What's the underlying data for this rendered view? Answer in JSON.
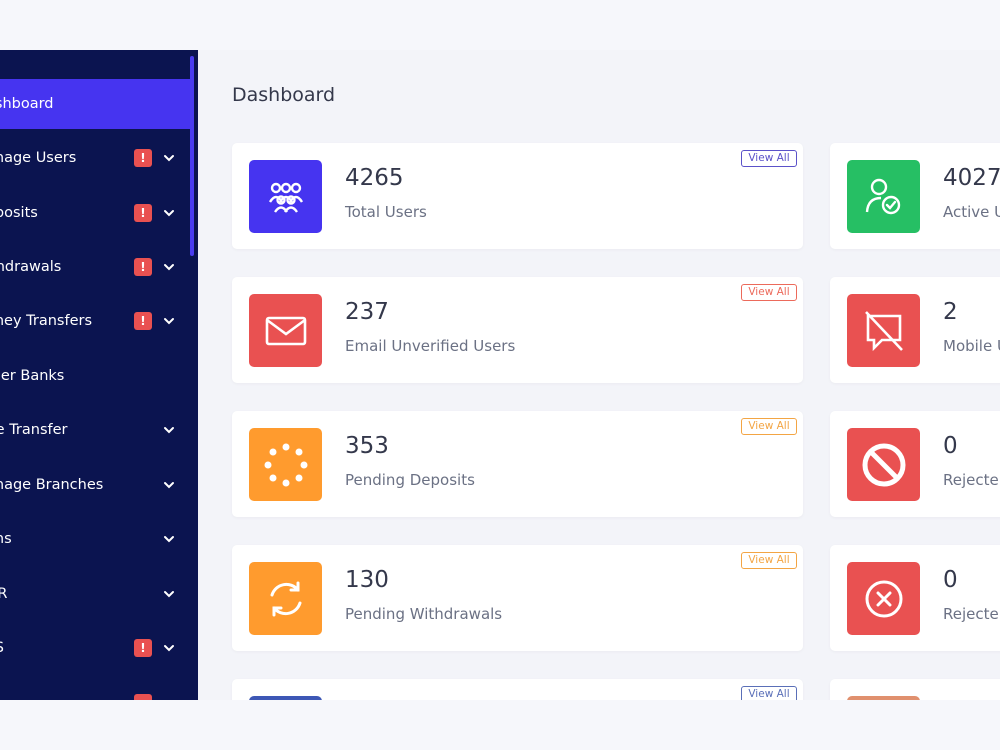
{
  "colors": {
    "sidebar_bg": "#0b1450",
    "accent": "#4634f0",
    "red": "#e95151",
    "green": "#26bf64",
    "orange": "#ff9b2e",
    "purple_border": "#5b52c9",
    "red_border": "#ec6a5b",
    "orange_border": "#f3a544",
    "blue_border": "#5a6fb8"
  },
  "sidebar": {
    "items": [
      {
        "label": "ashboard",
        "badge": "",
        "chevron": false
      },
      {
        "label": "anage Users",
        "badge": "!",
        "chevron": true
      },
      {
        "label": "eposits",
        "badge": "!",
        "chevron": true
      },
      {
        "label": "ithdrawals",
        "badge": "!",
        "chevron": true
      },
      {
        "label": "oney Transfers",
        "badge": "!",
        "chevron": true
      },
      {
        "label": "ther Banks",
        "badge": "",
        "chevron": false
      },
      {
        "label": "ire Transfer",
        "badge": "",
        "chevron": true
      },
      {
        "label": "anage Branches",
        "badge": "",
        "chevron": true
      },
      {
        "label": "ans",
        "badge": "",
        "chevron": true
      },
      {
        "label": "OR",
        "badge": "",
        "chevron": true
      },
      {
        "label": "PS",
        "badge": "!",
        "chevron": true
      }
    ]
  },
  "main": {
    "title": "Dashboard",
    "cards": [
      {
        "value": "4265",
        "label": "Total Users",
        "view_all": "View All",
        "icon": "users-icon"
      },
      {
        "value": "4027",
        "label": "Active U",
        "view_all": "",
        "icon": "user-check-icon"
      },
      {
        "value": "237",
        "label": "Email Unverified Users",
        "view_all": "View All",
        "icon": "envelope-icon"
      },
      {
        "value": "2",
        "label": "Mobile U",
        "view_all": "",
        "icon": "message-slash-icon"
      },
      {
        "value": "353",
        "label": "Pending Deposits",
        "view_all": "View All",
        "icon": "spinner-icon"
      },
      {
        "value": "0",
        "label": "Rejecte",
        "view_all": "",
        "icon": "ban-icon"
      },
      {
        "value": "130",
        "label": "Pending Withdrawals",
        "view_all": "View All",
        "icon": "refresh-icon"
      },
      {
        "value": "0",
        "label": "Rejecte",
        "view_all": "",
        "icon": "times-circle-icon"
      },
      {
        "value": "",
        "label": "",
        "view_all": "View All",
        "icon": "bank-icon"
      }
    ]
  }
}
